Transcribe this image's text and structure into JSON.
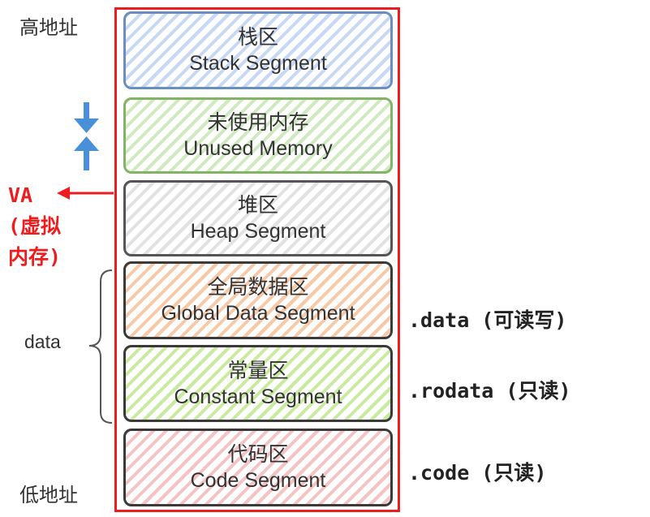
{
  "labels": {
    "high_address": "高地址",
    "low_address": "低地址",
    "data_group": "data"
  },
  "va": {
    "title": "VA",
    "line2": "(虚拟",
    "line3": "内存)"
  },
  "segments": [
    {
      "cn": "栈区",
      "en": "Stack Segment"
    },
    {
      "cn": "未使用内存",
      "en": "Unused Memory"
    },
    {
      "cn": "堆区",
      "en": "Heap Segment"
    },
    {
      "cn": "全局数据区",
      "en": "Global Data Segment"
    },
    {
      "cn": "常量区",
      "en": "Constant Segment"
    },
    {
      "cn": "代码区",
      "en": "Code Segment"
    }
  ],
  "sections": {
    "data": ".data (可读写)",
    "rodata": ".rodata (只读)",
    "code": ".code (只读)"
  },
  "colors": {
    "frame": "#ee1c1c",
    "grow_arrows": "#4a90d9",
    "stack": "#6c8ebf",
    "unused": "#82b366",
    "heap": "#555555",
    "global": "#f7c9a6",
    "constant": "#c9eba0",
    "code": "#f5c3c3"
  }
}
